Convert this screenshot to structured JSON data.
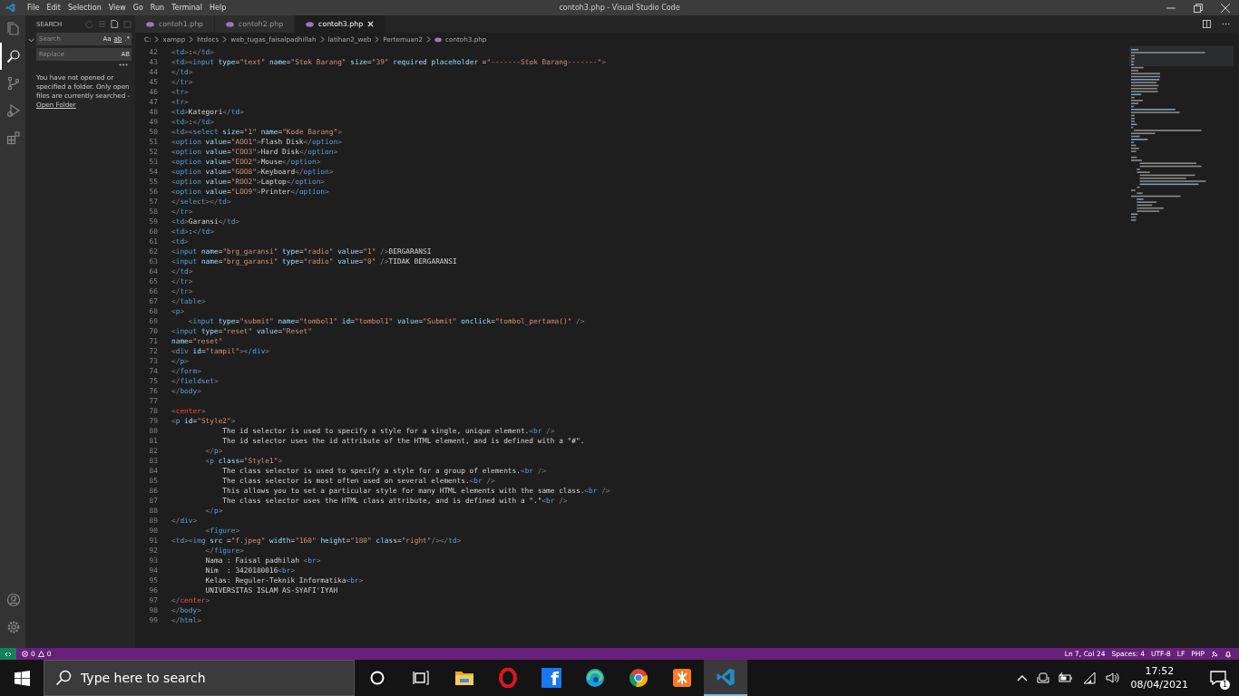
{
  "window": {
    "title": "contoh3.php - Visual Studio Code"
  },
  "menu": [
    "File",
    "Edit",
    "Selection",
    "View",
    "Go",
    "Run",
    "Terminal",
    "Help"
  ],
  "activity_bar": {
    "top": [
      {
        "kind": "explorer",
        "selected": false
      },
      {
        "kind": "search",
        "selected": true
      },
      {
        "kind": "scm",
        "selected": false
      },
      {
        "kind": "run",
        "selected": false
      },
      {
        "kind": "extensions",
        "selected": false
      }
    ],
    "bottom": [
      {
        "kind": "account",
        "selected": false
      },
      {
        "kind": "settings",
        "selected": false
      }
    ]
  },
  "sidebar": {
    "title": "SEARCH",
    "search": {
      "placeholder": "Search",
      "toggles": [
        "Aa",
        "ab",
        ".*"
      ]
    },
    "replace": {
      "placeholder": "Replace",
      "toggle": "AB"
    },
    "message": "You have not opened or specified a folder. Only open files are currently searched -",
    "link": "Open Folder"
  },
  "tabs": [
    {
      "label": "contoh1.php",
      "selected": false
    },
    {
      "label": "contoh2.php",
      "selected": false
    },
    {
      "label": "contoh3.php",
      "selected": true
    }
  ],
  "breadcrumbs": [
    "C:",
    "xampp",
    "htdocs",
    "web_tugas_faisalpadhillah",
    "latihan2_web",
    "Pertemuan2",
    "contoh3.php"
  ],
  "code": {
    "lines": [
      {
        "number": "42",
        "tokens": [
          {
            "kind": "tag",
            "text": "<td>"
          },
          {
            "kind": "text",
            "text": ":"
          },
          {
            "kind": "tag",
            "text": "</td>"
          }
        ]
      },
      {
        "number": "43",
        "tokens": [
          {
            "kind": "tag",
            "text": "<td>"
          },
          {
            "kind": "tag",
            "text": "<input"
          },
          {
            "kind": "attr",
            "text": " type="
          },
          {
            "kind": "str",
            "text": "\"text\""
          },
          {
            "kind": "attr",
            "text": " name="
          },
          {
            "kind": "str",
            "text": "\"Stok Barang\""
          },
          {
            "kind": "attr",
            "text": " size="
          },
          {
            "kind": "str",
            "text": "\"39\""
          },
          {
            "kind": "attr",
            "text": " required placeholder ="
          },
          {
            "kind": "str",
            "text": "\"-------Stok Barang-------\""
          },
          {
            "kind": "tag",
            "text": ">"
          }
        ]
      },
      {
        "number": "44",
        "tokens": [
          {
            "kind": "tag",
            "text": "</td>"
          }
        ]
      },
      {
        "number": "45",
        "tokens": [
          {
            "kind": "tag",
            "text": "</tr>"
          }
        ]
      },
      {
        "number": "46",
        "tokens": [
          {
            "kind": "tag",
            "text": "<tr>"
          }
        ]
      },
      {
        "number": "47",
        "tokens": [
          {
            "kind": "tag",
            "text": "<tr>"
          }
        ]
      },
      {
        "number": "48",
        "tokens": [
          {
            "kind": "tag",
            "text": "<td>"
          },
          {
            "kind": "text",
            "text": "Kategori"
          },
          {
            "kind": "tag",
            "text": "</td>"
          }
        ]
      },
      {
        "number": "49",
        "tokens": [
          {
            "kind": "tag",
            "text": "<td>"
          },
          {
            "kind": "text",
            "text": ":"
          },
          {
            "kind": "tag",
            "text": "</td>"
          }
        ]
      },
      {
        "number": "50",
        "tokens": [
          {
            "kind": "tag",
            "text": "<td>"
          },
          {
            "kind": "tag",
            "text": "<select"
          },
          {
            "kind": "attr",
            "text": " size="
          },
          {
            "kind": "str",
            "text": "\"1\""
          },
          {
            "kind": "attr",
            "text": " name="
          },
          {
            "kind": "str",
            "text": "\"Kode Barang\""
          },
          {
            "kind": "tag",
            "text": ">"
          }
        ]
      },
      {
        "number": "51",
        "tokens": [
          {
            "kind": "tag",
            "text": "<option"
          },
          {
            "kind": "attr",
            "text": " value="
          },
          {
            "kind": "str",
            "text": "\"AOO1\""
          },
          {
            "kind": "tag",
            "text": ">"
          },
          {
            "kind": "text",
            "text": "Flash Disk"
          },
          {
            "kind": "tag",
            "text": "</option>"
          }
        ]
      },
      {
        "number": "52",
        "tokens": [
          {
            "kind": "tag",
            "text": "<option"
          },
          {
            "kind": "attr",
            "text": " value="
          },
          {
            "kind": "str",
            "text": "\"COO3\""
          },
          {
            "kind": "tag",
            "text": ">"
          },
          {
            "kind": "text",
            "text": "Hard Disk"
          },
          {
            "kind": "tag",
            "text": "</option>"
          }
        ]
      },
      {
        "number": "53",
        "tokens": [
          {
            "kind": "tag",
            "text": "<option"
          },
          {
            "kind": "attr",
            "text": " value="
          },
          {
            "kind": "str",
            "text": "\"EOO2\""
          },
          {
            "kind": "tag",
            "text": ">"
          },
          {
            "kind": "text",
            "text": "Mouse"
          },
          {
            "kind": "tag",
            "text": "</option>"
          }
        ]
      },
      {
        "number": "54",
        "tokens": [
          {
            "kind": "tag",
            "text": "<option"
          },
          {
            "kind": "attr",
            "text": " value="
          },
          {
            "kind": "str",
            "text": "\"GOO8\""
          },
          {
            "kind": "tag",
            "text": ">"
          },
          {
            "kind": "text",
            "text": "Keyboard"
          },
          {
            "kind": "tag",
            "text": "</option>"
          }
        ]
      },
      {
        "number": "55",
        "tokens": [
          {
            "kind": "tag",
            "text": "<option"
          },
          {
            "kind": "attr",
            "text": " value="
          },
          {
            "kind": "str",
            "text": "\"ROO2\""
          },
          {
            "kind": "tag",
            "text": ">"
          },
          {
            "kind": "text",
            "text": "Laptop"
          },
          {
            "kind": "tag",
            "text": "</option>"
          }
        ]
      },
      {
        "number": "56",
        "tokens": [
          {
            "kind": "tag",
            "text": "<option"
          },
          {
            "kind": "attr",
            "text": " value="
          },
          {
            "kind": "str",
            "text": "\"LOO9\""
          },
          {
            "kind": "tag",
            "text": ">"
          },
          {
            "kind": "text",
            "text": "Printer"
          },
          {
            "kind": "tag",
            "text": "</option>"
          }
        ]
      },
      {
        "number": "57",
        "tokens": [
          {
            "kind": "tag",
            "text": "</select>"
          },
          {
            "kind": "tag",
            "text": "</td>"
          }
        ]
      },
      {
        "number": "58",
        "tokens": [
          {
            "kind": "tag",
            "text": "</tr>"
          }
        ]
      },
      {
        "number": "59",
        "tokens": [
          {
            "kind": "tag",
            "text": "<td>"
          },
          {
            "kind": "text",
            "text": "Garansi"
          },
          {
            "kind": "tag",
            "text": "</td>"
          }
        ]
      },
      {
        "number": "60",
        "tokens": [
          {
            "kind": "tag",
            "text": "<td>"
          },
          {
            "kind": "text",
            "text": ":"
          },
          {
            "kind": "tag",
            "text": "</td>"
          }
        ]
      },
      {
        "number": "61",
        "tokens": [
          {
            "kind": "tag",
            "text": "<td>"
          }
        ]
      },
      {
        "number": "62",
        "tokens": [
          {
            "kind": "tag",
            "text": "<input"
          },
          {
            "kind": "attr",
            "text": " name="
          },
          {
            "kind": "str",
            "text": "\"brg_garansi\""
          },
          {
            "kind": "attr",
            "text": " type="
          },
          {
            "kind": "str",
            "text": "\"radio\""
          },
          {
            "kind": "attr",
            "text": " value="
          },
          {
            "kind": "str",
            "text": "\"1\""
          },
          {
            "kind": "tag",
            "text": " />"
          },
          {
            "kind": "text",
            "text": "BERGARANSI"
          }
        ]
      },
      {
        "number": "63",
        "tokens": [
          {
            "kind": "tag",
            "text": "<input"
          },
          {
            "kind": "attr",
            "text": " name="
          },
          {
            "kind": "str",
            "text": "\"brg_garansi\""
          },
          {
            "kind": "attr",
            "text": " type="
          },
          {
            "kind": "str",
            "text": "\"radio\""
          },
          {
            "kind": "attr",
            "text": " value="
          },
          {
            "kind": "str",
            "text": "\"0\""
          },
          {
            "kind": "tag",
            "text": " />"
          },
          {
            "kind": "text",
            "text": "TIDAK BERGARANSI"
          }
        ]
      },
      {
        "number": "64",
        "tokens": [
          {
            "kind": "tag",
            "text": "</td>"
          }
        ]
      },
      {
        "number": "65",
        "tokens": [
          {
            "kind": "tag",
            "text": "</tr>"
          }
        ]
      },
      {
        "number": "66",
        "tokens": [
          {
            "kind": "tag",
            "text": "</tr>"
          }
        ]
      },
      {
        "number": "67",
        "tokens": [
          {
            "kind": "tag",
            "text": "</table>"
          }
        ]
      },
      {
        "number": "68",
        "tokens": [
          {
            "kind": "tag",
            "text": "<p>"
          }
        ]
      },
      {
        "number": "69",
        "tokens": [
          {
            "kind": "tag",
            "text": "    <input"
          },
          {
            "kind": "attr",
            "text": " type="
          },
          {
            "kind": "str",
            "text": "\"submit\""
          },
          {
            "kind": "attr",
            "text": " name="
          },
          {
            "kind": "str",
            "text": "\"tombol1\""
          },
          {
            "kind": "attr",
            "text": " id="
          },
          {
            "kind": "str",
            "text": "\"tombol1\""
          },
          {
            "kind": "attr",
            "text": " value="
          },
          {
            "kind": "str",
            "text": "\"Submit\""
          },
          {
            "kind": "attr",
            "text": " onclick="
          },
          {
            "kind": "str",
            "text": "\"tombol_pertama()\""
          },
          {
            "kind": "tag",
            "text": " />"
          }
        ]
      },
      {
        "number": "70",
        "tokens": [
          {
            "kind": "tag",
            "text": "<input"
          },
          {
            "kind": "attr",
            "text": " type="
          },
          {
            "kind": "str",
            "text": "\"reset\""
          },
          {
            "kind": "attr",
            "text": " value="
          },
          {
            "kind": "str",
            "text": "\"Reset\""
          }
        ]
      },
      {
        "number": "71",
        "tokens": [
          {
            "kind": "attr",
            "text": "name="
          },
          {
            "kind": "str",
            "text": "\"reset\""
          }
        ]
      },
      {
        "number": "72",
        "tokens": [
          {
            "kind": "tag",
            "text": "<div"
          },
          {
            "kind": "attr",
            "text": " id="
          },
          {
            "kind": "str",
            "text": "\"tampil\""
          },
          {
            "kind": "tag",
            "text": ">"
          },
          {
            "kind": "tag",
            "text": "</div>"
          }
        ]
      },
      {
        "number": "73",
        "tokens": [
          {
            "kind": "tag",
            "text": "</p>"
          }
        ]
      },
      {
        "number": "74",
        "tokens": [
          {
            "kind": "tag",
            "text": "</form>"
          }
        ]
      },
      {
        "number": "75",
        "tokens": [
          {
            "kind": "tag",
            "text": "</fieldset>"
          }
        ]
      },
      {
        "number": "76",
        "tokens": [
          {
            "kind": "tag",
            "text": "</body>"
          }
        ]
      },
      {
        "number": "77"
      },
      {
        "number": "78",
        "tokens": [
          {
            "kind": "deprecated",
            "text": "<center>"
          }
        ]
      },
      {
        "number": "79",
        "tokens": [
          {
            "kind": "tag",
            "text": "<p"
          },
          {
            "kind": "attr",
            "text": " id="
          },
          {
            "kind": "str",
            "text": "\"Style2\""
          },
          {
            "kind": "tag",
            "text": ">"
          }
        ]
      },
      {
        "number": "80",
        "tokens": [
          {
            "kind": "text",
            "text": "            The id selector is used to specify a style for a single, unique element."
          },
          {
            "kind": "tag",
            "text": "<br />"
          }
        ]
      },
      {
        "number": "81",
        "tokens": [
          {
            "kind": "text",
            "text": "            The id selector uses the id attribute of the HTML element, and is defined with a \"#\"."
          }
        ]
      },
      {
        "number": "82",
        "tokens": [
          {
            "kind": "tag",
            "text": "        </p>"
          }
        ]
      },
      {
        "number": "83",
        "tokens": [
          {
            "kind": "tag",
            "text": "        <p"
          },
          {
            "kind": "attr",
            "text": " class="
          },
          {
            "kind": "str",
            "text": "\"Style1\""
          },
          {
            "kind": "tag",
            "text": ">"
          }
        ]
      },
      {
        "number": "84",
        "tokens": [
          {
            "kind": "text",
            "text": "            The class selector is used to specify a style for a group of elements."
          },
          {
            "kind": "tag",
            "text": "<br />"
          }
        ]
      },
      {
        "number": "85",
        "tokens": [
          {
            "kind": "text",
            "text": "            The class selector is most often used on several elements."
          },
          {
            "kind": "tag",
            "text": "<br />"
          }
        ]
      },
      {
        "number": "86",
        "tokens": [
          {
            "kind": "text",
            "text": "            This allows you to set a particular style for many HTML elements with the same class."
          },
          {
            "kind": "tag",
            "text": "<br />"
          }
        ]
      },
      {
        "number": "87",
        "tokens": [
          {
            "kind": "text",
            "text": "            The class selector uses the HTML class attribute, and is defined with a \".\""
          },
          {
            "kind": "tag",
            "text": "<br />"
          }
        ]
      },
      {
        "number": "88",
        "tokens": [
          {
            "kind": "tag",
            "text": "        </p>"
          }
        ]
      },
      {
        "number": "89",
        "tokens": [
          {
            "kind": "tag",
            "text": "</div>"
          }
        ]
      },
      {
        "number": "90",
        "tokens": [
          {
            "kind": "tag",
            "text": "        <figure>"
          }
        ]
      },
      {
        "number": "91",
        "tokens": [
          {
            "kind": "tag",
            "text": "<td>"
          },
          {
            "kind": "tag",
            "text": "<img"
          },
          {
            "kind": "attr",
            "text": " src ="
          },
          {
            "kind": "str",
            "text": "\"f.jpeg\""
          },
          {
            "kind": "attr",
            "text": " width="
          },
          {
            "kind": "str",
            "text": "\"160\""
          },
          {
            "kind": "attr",
            "text": " height="
          },
          {
            "kind": "str",
            "text": "\"180\""
          },
          {
            "kind": "attr",
            "text": " class="
          },
          {
            "kind": "str",
            "text": "\"right\""
          },
          {
            "kind": "tag",
            "text": "/>"
          },
          {
            "kind": "tag",
            "text": "</td>"
          }
        ]
      },
      {
        "number": "92",
        "tokens": [
          {
            "kind": "tag",
            "text": "        </figure>"
          }
        ]
      },
      {
        "number": "93",
        "tokens": [
          {
            "kind": "text",
            "text": "        Nama : Faisal padhilah "
          },
          {
            "kind": "tag",
            "text": "<br>"
          }
        ]
      },
      {
        "number": "94",
        "tokens": [
          {
            "kind": "text",
            "text": "        Nim  : 3420180016"
          },
          {
            "kind": "tag",
            "text": "<br>"
          }
        ]
      },
      {
        "number": "95",
        "tokens": [
          {
            "kind": "text",
            "text": "        Kelas: Reguler-Teknik Informatika"
          },
          {
            "kind": "tag",
            "text": "<br>"
          }
        ]
      },
      {
        "number": "96",
        "tokens": [
          {
            "kind": "text",
            "text": "        UNIVERSITAS ISLAM AS-SYAFI'IYAH"
          }
        ]
      },
      {
        "number": "97",
        "tokens": [
          {
            "kind": "deprecated",
            "text": "</center>"
          }
        ]
      },
      {
        "number": "98",
        "tokens": [
          {
            "kind": "tag",
            "text": "</body>"
          }
        ]
      },
      {
        "number": "99",
        "tokens": [
          {
            "kind": "tag",
            "text": "</html>"
          }
        ]
      }
    ]
  },
  "status_bar": {
    "errors": "0",
    "warnings": "0",
    "items": [
      "Ln 7, Col 24",
      "Spaces: 4",
      "UTF-8",
      "LF",
      "PHP"
    ]
  },
  "taskbar": {
    "search": {
      "placeholder": "Type here to search"
    },
    "apps": [
      {
        "kind": "cortana",
        "selected": false
      },
      {
        "kind": "taskview",
        "selected": false
      },
      {
        "kind": "folder",
        "selected": false
      },
      {
        "kind": "ring",
        "selected": false
      },
      {
        "kind": "letter",
        "glyph": "f",
        "selected": false
      },
      {
        "kind": "swirl",
        "selected": false
      },
      {
        "kind": "pinwheel",
        "selected": false
      },
      {
        "kind": "square",
        "selected": false
      },
      {
        "kind": "ribbon",
        "selected": true
      }
    ],
    "time": "17:52",
    "date": "08/04/2021",
    "notifications": "1"
  }
}
